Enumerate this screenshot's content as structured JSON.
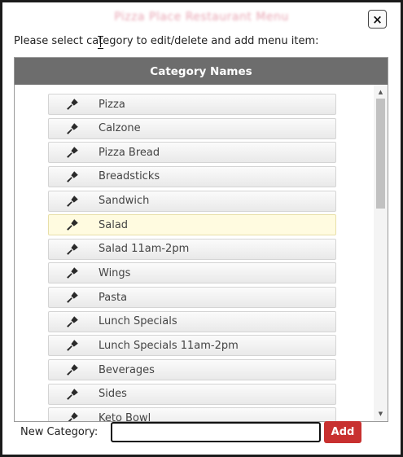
{
  "dialog": {
    "title": "Pizza Place Restaurant Menu",
    "close_label": "×",
    "instruction": "Please select category to edit/delete and add menu item:"
  },
  "table": {
    "header": "Category Names",
    "icon": "paint-brush-icon",
    "items": [
      {
        "label": "Pizza"
      },
      {
        "label": "Calzone"
      },
      {
        "label": "Pizza Bread"
      },
      {
        "label": "Breadsticks"
      },
      {
        "label": "Sandwich"
      },
      {
        "label": "Salad"
      },
      {
        "label": "Salad 11am-2pm"
      },
      {
        "label": "Wings"
      },
      {
        "label": "Pasta"
      },
      {
        "label": "Lunch Specials"
      },
      {
        "label": "Lunch Specials 11am-2pm"
      },
      {
        "label": "Beverages"
      },
      {
        "label": "Sides"
      },
      {
        "label": "Keto Bowl"
      }
    ],
    "highlighted_item": "Salad"
  },
  "form": {
    "new_category_label": "New Category:",
    "new_category_value": "",
    "add_label": "Add"
  },
  "colors": {
    "header_bg": "#6d6d6d",
    "add_button": "#c8302f",
    "highlight_row": "#fffbe0"
  }
}
